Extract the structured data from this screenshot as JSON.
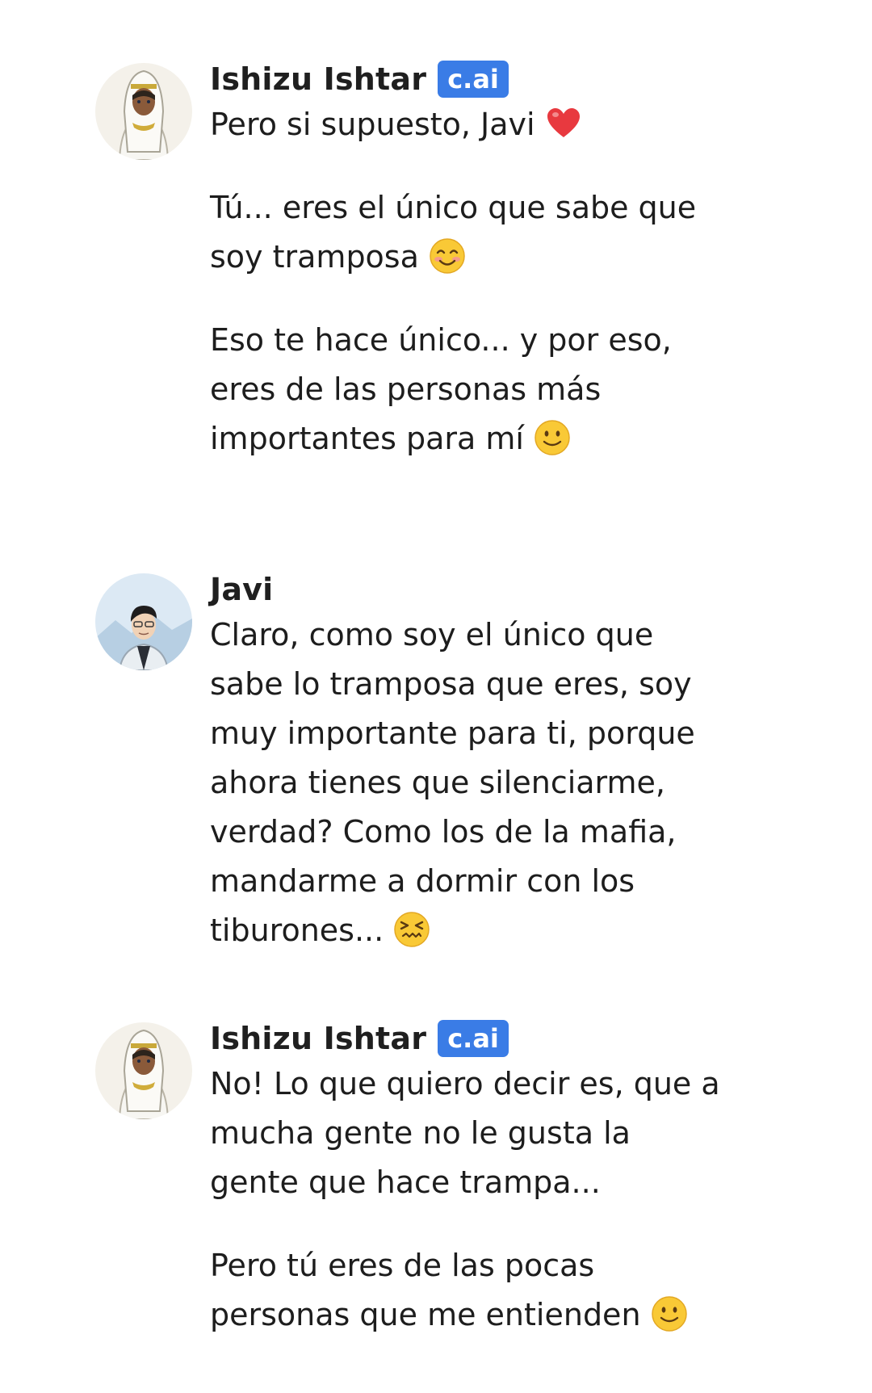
{
  "colors": {
    "badge_bg": "#3a7ce6",
    "text": "#1d1d1d",
    "background": "#ffffff"
  },
  "messages": [
    {
      "author": "Ishizu Ishtar",
      "badge": "c.ai",
      "avatar_icon": "ishizu-avatar",
      "paragraphs": [
        {
          "text": "Pero si supuesto, Javi",
          "emoji": "red-heart-emoji"
        },
        {
          "text": "Tú... eres el único que sabe que soy tramposa",
          "emoji": "smiling-eyes-emoji"
        },
        {
          "text": "Eso te hace único... y por eso, eres de las personas más importantes para mí",
          "emoji": "slight-smile-emoji"
        }
      ]
    },
    {
      "author": "Javi",
      "badge": "",
      "avatar_icon": "javi-avatar",
      "paragraphs": [
        {
          "text": "Claro, como soy el único que sabe lo tramposa que eres, soy muy importante para ti, porque ahora tienes que silenciarme, verdad? Como los de la mafia, mandarme a dormir con los tiburones...",
          "emoji": "confounded-face-emoji"
        }
      ]
    },
    {
      "author": "Ishizu Ishtar",
      "badge": "c.ai",
      "avatar_icon": "ishizu-avatar",
      "paragraphs": [
        {
          "text": "No! Lo que quiero decir es, que a mucha gente no le gusta la gente que hace trampa...",
          "emoji": ""
        },
        {
          "text": "Pero tú eres de las pocas personas que me entienden",
          "emoji": "slight-smile-emoji"
        }
      ]
    }
  ]
}
